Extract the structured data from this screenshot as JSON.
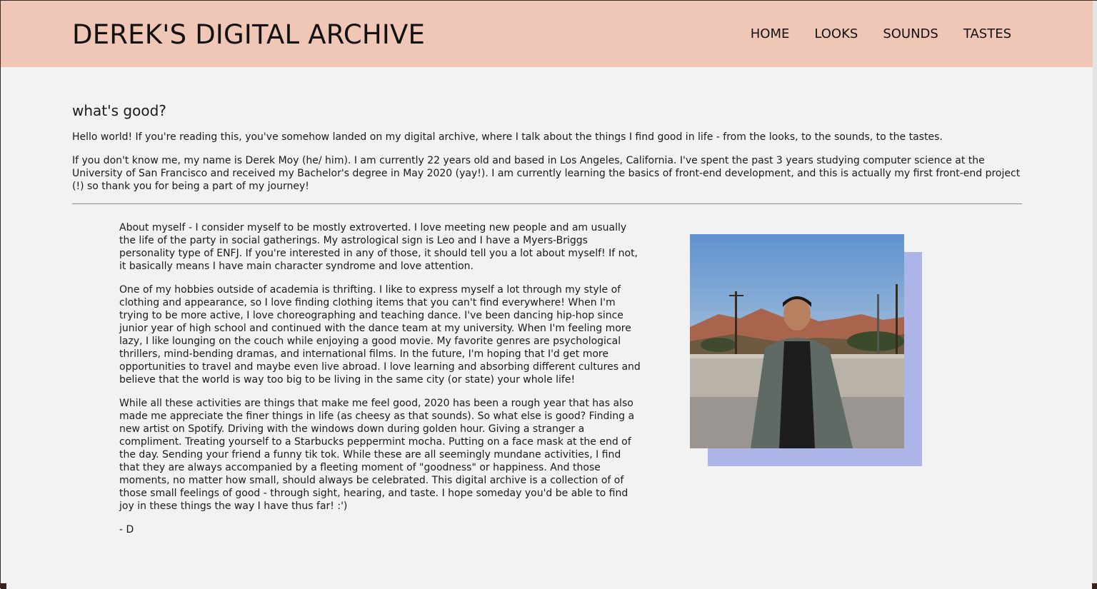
{
  "header": {
    "site_title": "DEREK'S DIGITAL ARCHIVE",
    "nav": [
      "HOME",
      "LOOKS",
      "SOUNDS",
      "TASTES"
    ]
  },
  "intro": {
    "heading": "what's good?",
    "paragraphs": [
      "Hello world! If you're reading this, you've somehow landed on my digital archive, where I talk about the things I find good in life - from the looks, to the sounds, to the tastes.",
      "If you don't know me, my name is Derek Moy (he/ him). I am currently 22 years old and based in Los Angeles, California. I've spent the past 3 years studying computer science at the University of San Francisco and received my Bachelor's degree in May 2020 (yay!). I am currently learning the basics of front-end development, and this is actually my first front-end project (!) so thank you for being a part of my journey!"
    ]
  },
  "about": {
    "paragraphs": [
      "About myself - I consider myself to be mostly extroverted. I love meeting new people and am usually the life of the party in social gatherings. My astrological sign is Leo and I have a Myers-Briggs personality type of ENFJ. If you're interested in any of those, it should tell you a lot about myself! If not, it basically means I have main character syndrome and love attention.",
      "One of my hobbies outside of academia is thrifting. I like to express myself a lot through my style of clothing and appearance, so I love finding clothing items that you can't find everywhere! When I'm trying to be more active, I love choreographing and teaching dance. I've been dancing hip-hop since junior year of high school and continued with the dance team at my university. When I'm feeling more lazy, I like lounging on the couch while enjoying a good movie. My favorite genres are psychological thrillers, mind-bending dramas, and international films. In the future, I'm hoping that I'd get more opportunities to travel and maybe even live abroad. I love learning and absorbing different cultures and believe that the world is way too big to be living in the same city (or state) your whole life!",
      "While all these activities are things that make me feel good, 2020 has been a rough year that has also made me appreciate the finer things in life (as cheesy as that sounds). So what else is good? Finding a new artist on Spotify. Driving with the windows down during golden hour. Giving a stranger a compliment. Treating yourself to a Starbucks peppermint mocha. Putting on a face mask at the end of the day. Sending your friend a funny tik tok. While these are all seemingly mundane activities, I find that they are always accompanied by a fleeting moment of \"goodness\" or happiness. And those moments, no matter how small, should always be celebrated. This digital archive is a collection of of those small feelings of good - through sight, hearing, and taste. I hope someday you'd be able to find joy in these things the way I have thus far! :')",
      "- D"
    ]
  },
  "colors": {
    "header_bg": "#f0c6b6",
    "page_bg": "#f2f2f2",
    "photo_shadow": "#adb4e8"
  }
}
